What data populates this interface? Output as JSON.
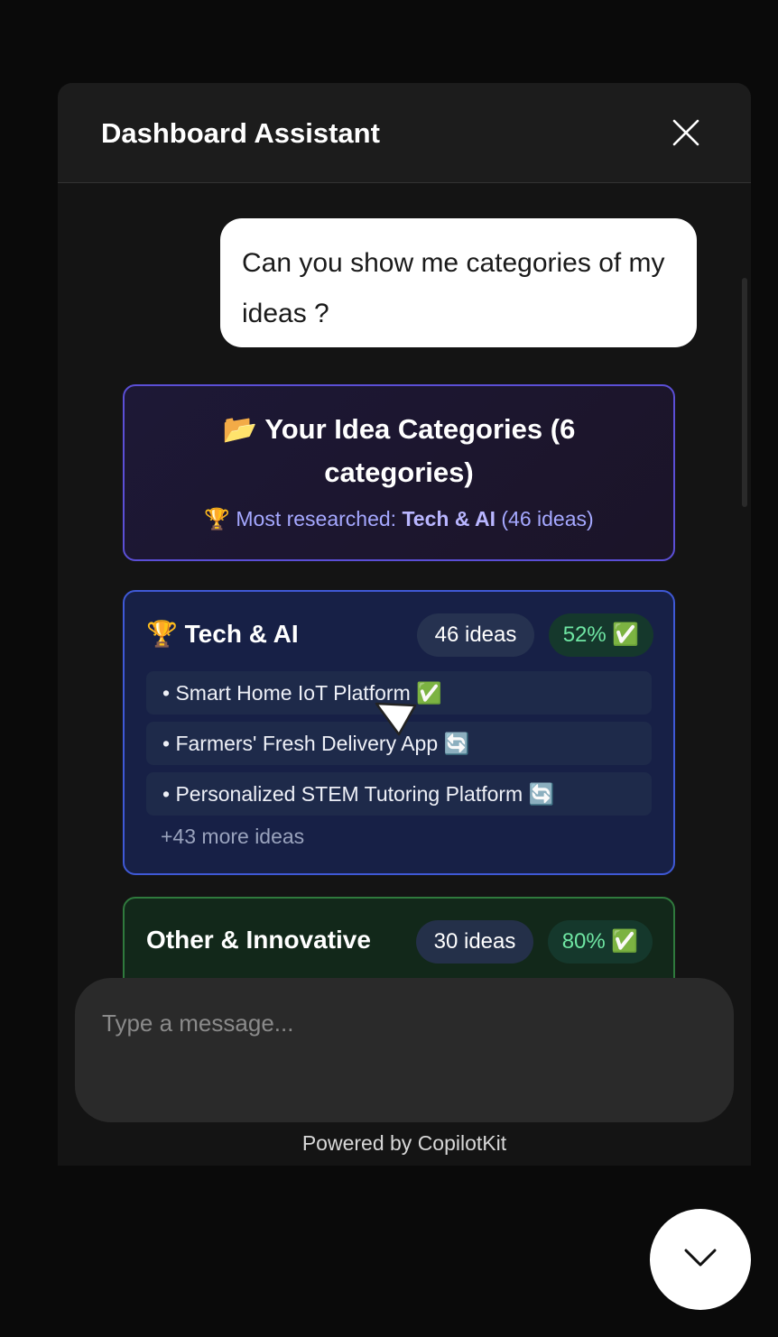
{
  "header": {
    "title": "Dashboard Assistant",
    "close_icon": "close-icon"
  },
  "conversation": {
    "user_message": "Can you show me categories of my ideas ?",
    "summary": {
      "icon": "📂",
      "title": "Your Idea Categories (6 categories)",
      "trophy_icon": "🏆",
      "most_prefix": "Most researched:",
      "most_name": "Tech & AI",
      "most_suffix": "(46 ideas)"
    },
    "categories": [
      {
        "icon": "🏆",
        "name": "Tech & AI",
        "count": "46 ideas",
        "percent": "52% ✅",
        "ideas": [
          "• Smart Home IoT Platform ✅",
          "• Farmers' Fresh Delivery App 🔄",
          "• Personalized STEM Tutoring Platform 🔄"
        ],
        "more": "+43 more ideas",
        "accent": "#3f59d6"
      },
      {
        "icon": "",
        "name": "Other & Innovative",
        "count": "30 ideas",
        "percent": "80% ✅",
        "accent": "#2f7a3d"
      }
    ]
  },
  "input": {
    "placeholder": "Type a message..."
  },
  "footer": {
    "powered_by": "Powered by CopilotKit"
  },
  "toggle": {
    "icon": "chevron-down-icon"
  }
}
